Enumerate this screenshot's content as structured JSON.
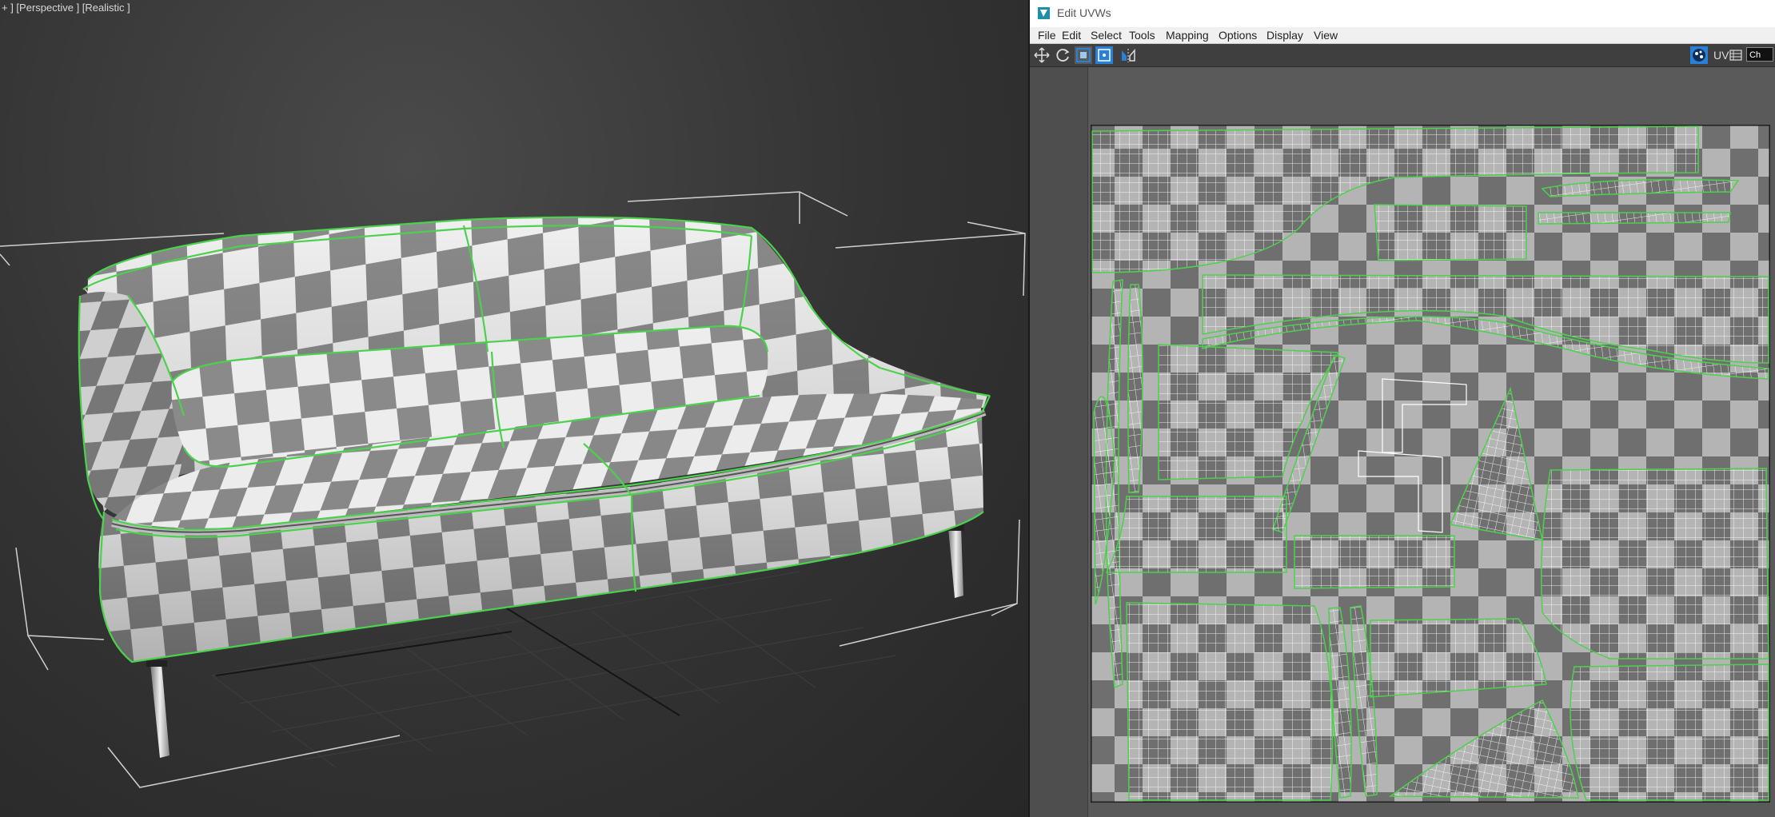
{
  "viewport": {
    "label": "+ ] [Perspective ] [Realistic ]"
  },
  "uv_editor": {
    "title": "Edit UVWs",
    "menu": [
      "File",
      "Edit",
      "Select",
      "Tools",
      "Mapping",
      "Options",
      "Display",
      "View"
    ],
    "uv_label": "UV",
    "channel_label": "Ch"
  },
  "colors": {
    "seam_green": "#4cd14c",
    "checker_dark": "#7d7d7d",
    "checker_light": "#e8e8e8",
    "uv_grid_dark": "#707070",
    "uv_grid_light": "#b5b5b5",
    "toolbar_accent": "#2a7fd6"
  },
  "icons": {
    "move": "move-icon",
    "rotate": "rotate-icon",
    "scale": "scale-icon",
    "freeform": "freeform-icon",
    "mirror": "mirror-icon",
    "checker": "checker-map-icon",
    "list": "list-icon"
  }
}
